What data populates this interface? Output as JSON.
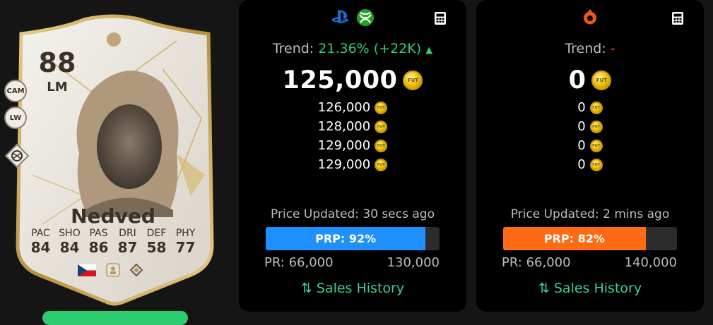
{
  "card": {
    "rating": "88",
    "position": "LM",
    "alt_positions": [
      "CAM",
      "LW"
    ],
    "name": "Nedved",
    "stats": [
      {
        "label": "PAC",
        "value": "84"
      },
      {
        "label": "SHO",
        "value": "84"
      },
      {
        "label": "PAS",
        "value": "86"
      },
      {
        "label": "DRI",
        "value": "87"
      },
      {
        "label": "DEF",
        "value": "58"
      },
      {
        "label": "PHY",
        "value": "77"
      }
    ],
    "nation_icon": "czech-flag-icon",
    "club_icon": "icons-club-badge-icon",
    "league_icon": "icons-league-icon"
  },
  "console": {
    "platform_icons": [
      "playstation-icon",
      "xbox-icon"
    ],
    "trend_label": "Trend:",
    "trend_value": "21.36% (+22K)",
    "trend_arrow": "▲",
    "price": "125,000",
    "other_prices": [
      "126,000",
      "128,000",
      "129,000",
      "129,000"
    ],
    "updated": "Price Updated: 30 secs ago",
    "prp_label": "PRP: 92%",
    "prp_percent": 92,
    "pr_min": "PR: 66,000",
    "pr_max": "130,000",
    "sales_history": "Sales History",
    "bar_color": "#1e90ff"
  },
  "pc": {
    "platform_icons": [
      "origin-icon"
    ],
    "trend_label": "Trend:",
    "trend_value": "-",
    "price": "0",
    "other_prices": [
      "0",
      "0",
      "0",
      "0"
    ],
    "updated": "Price Updated: 2 mins ago",
    "prp_label": "PRP: 82%",
    "prp_percent": 82,
    "pr_min": "PR: 66,000",
    "pr_max": "140,000",
    "sales_history": "Sales History",
    "bar_color": "#ff6a14"
  },
  "coin_label": "FUT",
  "colors": {
    "trend_up": "#2ecc71",
    "sales_link": "#3fcf8e",
    "panel_bg": "#000000"
  }
}
